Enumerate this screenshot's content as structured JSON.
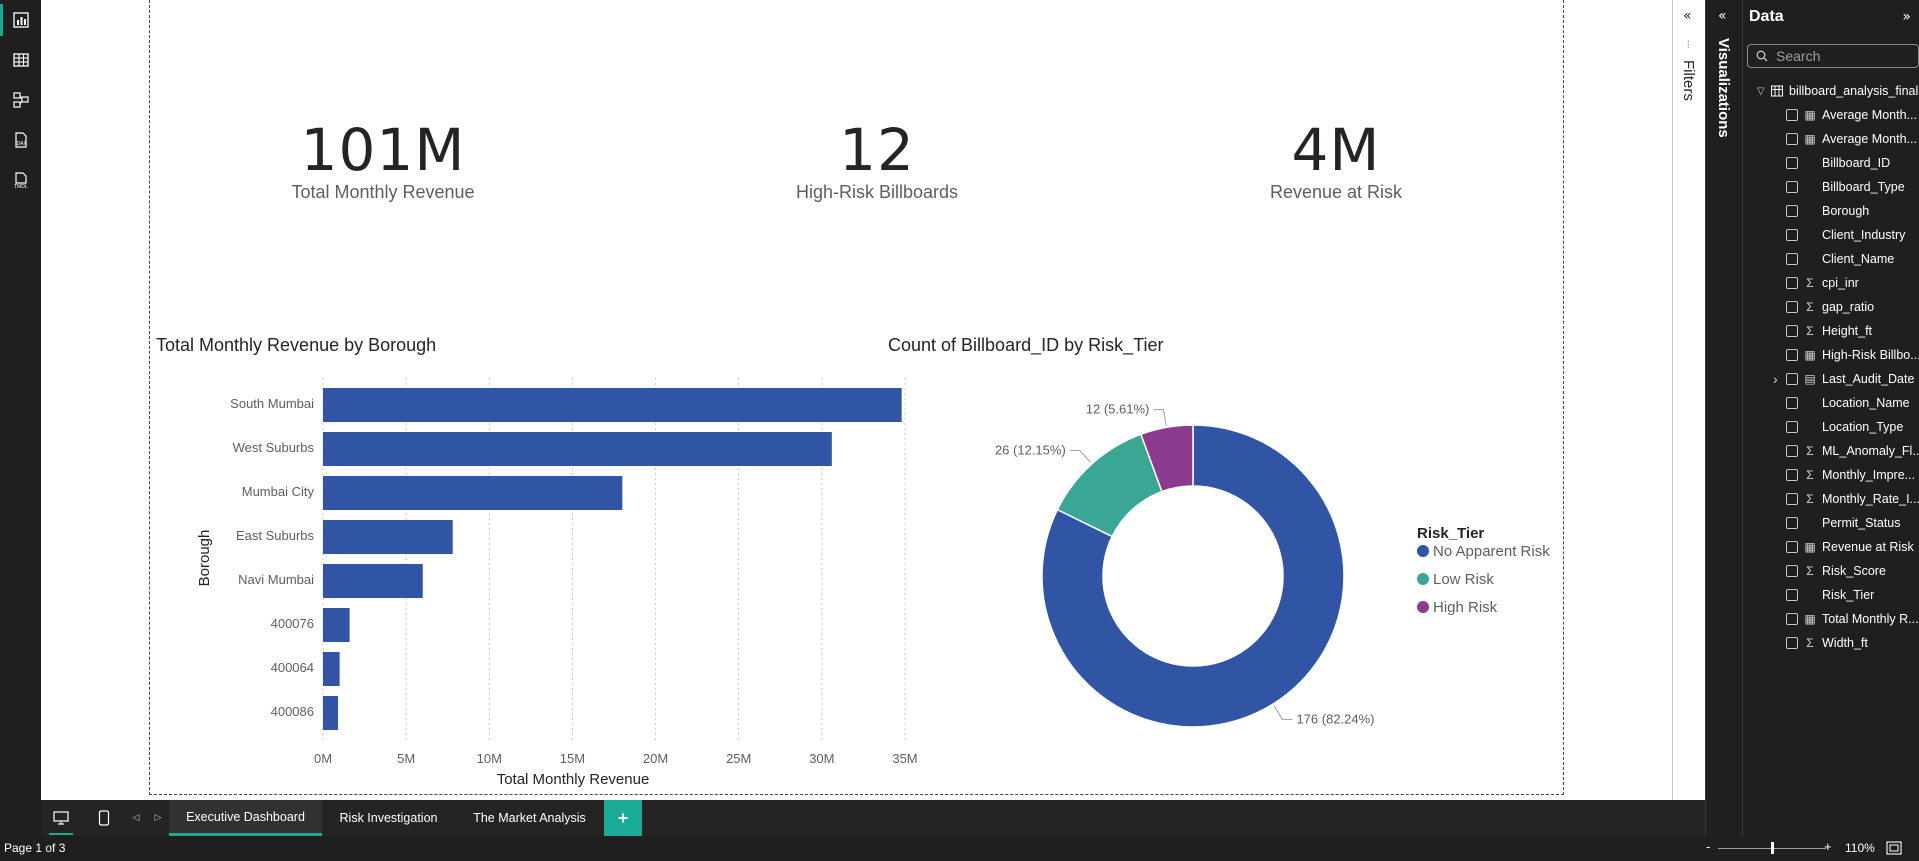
{
  "kpis": [
    {
      "value": "101M",
      "label": "Total Monthly Revenue"
    },
    {
      "value": "12",
      "label": "High-Risk Billboards"
    },
    {
      "value": "4M",
      "label": "Revenue at Risk"
    }
  ],
  "chart_data": [
    {
      "type": "bar",
      "orientation": "horizontal",
      "title": "Total Monthly Revenue by Borough",
      "xlabel": "Total Monthly Revenue",
      "ylabel": "Borough",
      "categories": [
        "South Mumbai",
        "West Suburbs",
        "Mumbai City",
        "East Suburbs",
        "Navi Mumbai",
        "400076",
        "400064",
        "400086"
      ],
      "values": [
        34.8,
        30.6,
        18.0,
        7.8,
        6.0,
        1.6,
        1.0,
        0.9
      ],
      "value_unit": "M",
      "xlim": [
        0,
        35
      ],
      "xticks": [
        "0M",
        "5M",
        "10M",
        "15M",
        "20M",
        "25M",
        "30M",
        "35M"
      ],
      "xtick_values": [
        0,
        5,
        10,
        15,
        20,
        25,
        30,
        35
      ],
      "color": "#2f55a4",
      "grid": "vertical dotted"
    },
    {
      "type": "pie",
      "style": "donut",
      "title": "Count of Billboard_ID by Risk_Tier",
      "legend_title": "Risk_Tier",
      "legend_position": "right",
      "slices": [
        {
          "name": "No Apparent Risk",
          "value": 176,
          "label": "176 (82.24%)",
          "color": "#2f55a4"
        },
        {
          "name": "Low Risk",
          "value": 26,
          "label": "26 (12.15%)",
          "color": "#3aa794"
        },
        {
          "name": "High Risk",
          "value": 12,
          "label": "12 (5.61%)",
          "color": "#8c3b8e"
        }
      ]
    }
  ],
  "panes": {
    "filters_label": "Filters",
    "visualizations_label": "Visualizations",
    "data_title": "Data",
    "search_placeholder": "Search",
    "table_name": "billboard_analysis_final",
    "fields": [
      {
        "name": "Average Month...",
        "icon": "calc-icon"
      },
      {
        "name": "Average Month...",
        "icon": "calc-icon"
      },
      {
        "name": "Billboard_ID",
        "icon": "none"
      },
      {
        "name": "Billboard_Type",
        "icon": "none"
      },
      {
        "name": "Borough",
        "icon": "none"
      },
      {
        "name": "Client_Industry",
        "icon": "none"
      },
      {
        "name": "Client_Name",
        "icon": "none"
      },
      {
        "name": "cpi_inr",
        "icon": "sigma-icon"
      },
      {
        "name": "gap_ratio",
        "icon": "sigma-icon"
      },
      {
        "name": "Height_ft",
        "icon": "sigma-icon"
      },
      {
        "name": "High-Risk Billbo...",
        "icon": "calc-icon"
      },
      {
        "name": "Last_Audit_Date",
        "icon": "calendar-icon",
        "expandable": true
      },
      {
        "name": "Location_Name",
        "icon": "none"
      },
      {
        "name": "Location_Type",
        "icon": "none"
      },
      {
        "name": "ML_Anomaly_Fl...",
        "icon": "sigma-icon"
      },
      {
        "name": "Monthly_Impre...",
        "icon": "sigma-icon"
      },
      {
        "name": "Monthly_Rate_I...",
        "icon": "sigma-icon"
      },
      {
        "name": "Permit_Status",
        "icon": "none"
      },
      {
        "name": "Revenue at Risk",
        "icon": "calc-icon"
      },
      {
        "name": "Risk_Score",
        "icon": "sigma-icon"
      },
      {
        "name": "Risk_Tier",
        "icon": "none"
      },
      {
        "name": "Total Monthly R...",
        "icon": "calc-icon"
      },
      {
        "name": "Width_ft",
        "icon": "sigma-icon"
      }
    ]
  },
  "tabs": [
    "Executive Dashboard",
    "Risk Investigation",
    "The Market Analysis"
  ],
  "add_tab_label": "+",
  "status": {
    "page": "Page 1 of 3",
    "zoom": "110%",
    "zoom_minus": "-",
    "zoom_plus": "+",
    "zoom_level": 0.5
  },
  "colors": {
    "accent": "#1aab98",
    "bar": "#2f55a4"
  }
}
